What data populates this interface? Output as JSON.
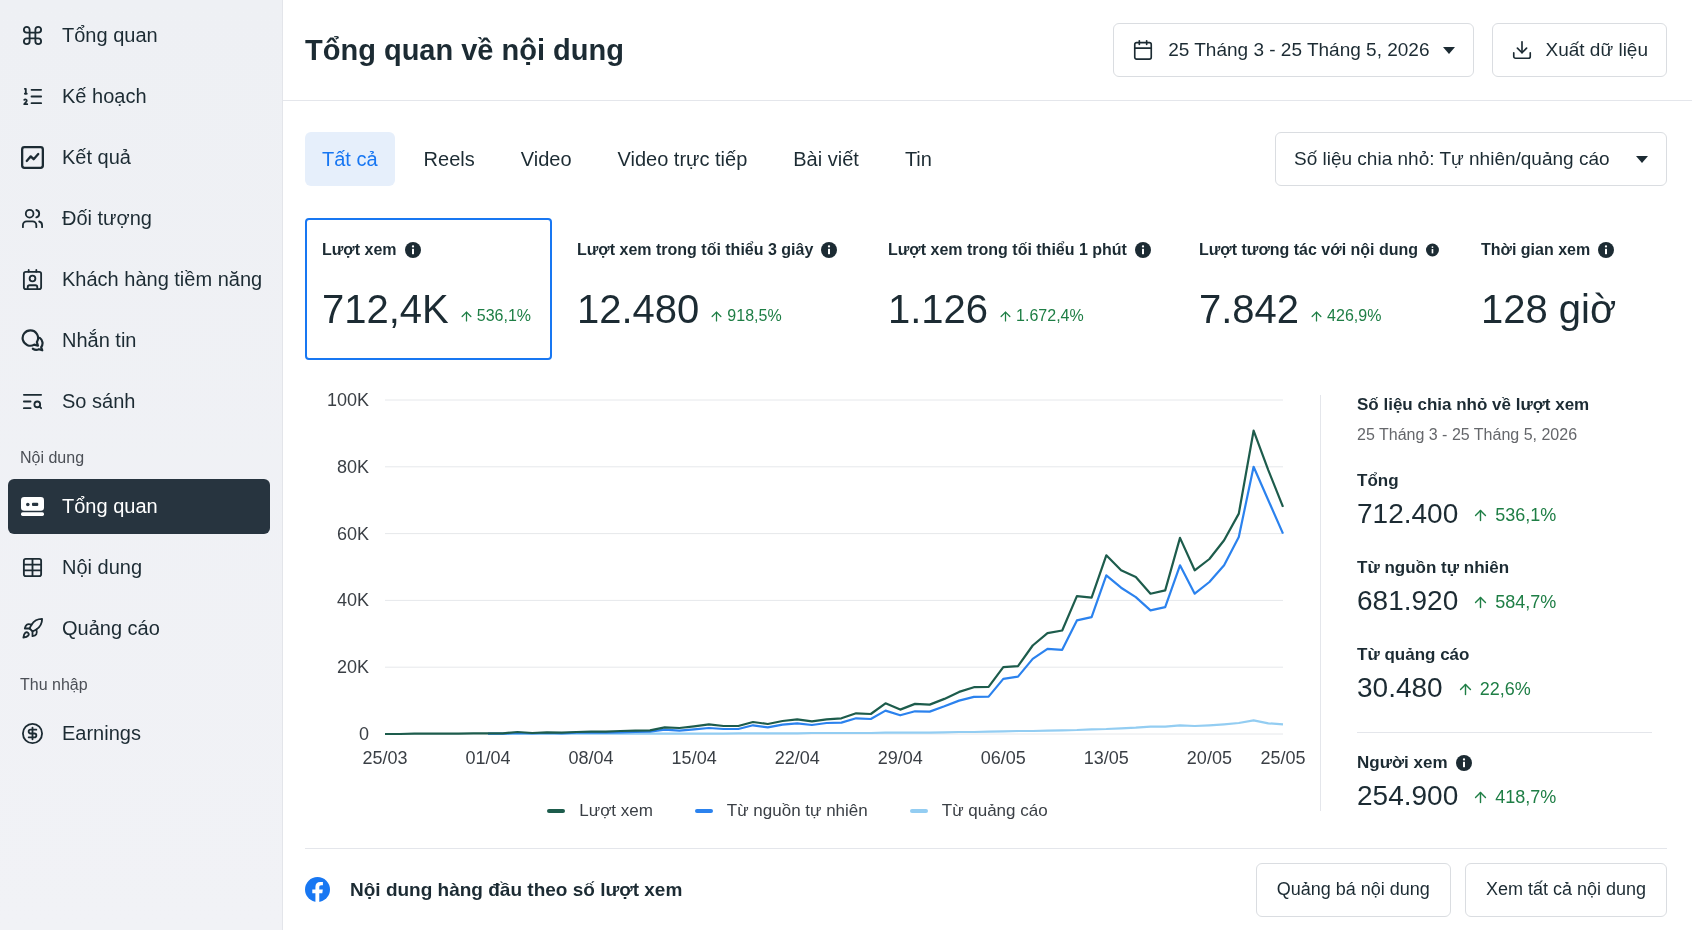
{
  "sidebar": {
    "groups": [
      {
        "items": [
          {
            "label": "Tổng quan",
            "selected": false
          },
          {
            "label": "Kế hoạch",
            "selected": false
          },
          {
            "label": "Kết quả",
            "selected": false
          },
          {
            "label": "Đối tượng",
            "selected": false
          },
          {
            "label": "Khách hàng tiềm năng",
            "selected": false
          },
          {
            "label": "Nhắn tin",
            "selected": false
          },
          {
            "label": "So sánh",
            "selected": false
          }
        ]
      },
      {
        "heading": "Nội dung",
        "items": [
          {
            "label": "Tổng quan",
            "selected": true
          },
          {
            "label": "Nội dung",
            "selected": false
          },
          {
            "label": "Quảng cáo",
            "selected": false
          }
        ]
      },
      {
        "heading": "Thu nhập",
        "items": [
          {
            "label": "Earnings",
            "selected": false
          }
        ]
      }
    ]
  },
  "header": {
    "title": "Tổng quan về nội dung",
    "date_range": "25 Tháng 3 - 25 Tháng 5, 2026",
    "export_button": "Xuất dữ liệu"
  },
  "tabs": [
    {
      "label": "Tất cả",
      "selected": true
    },
    {
      "label": "Reels",
      "selected": false
    },
    {
      "label": "Video",
      "selected": false
    },
    {
      "label": "Video trực tiếp",
      "selected": false
    },
    {
      "label": "Bài viết",
      "selected": false
    },
    {
      "label": "Tin",
      "selected": false
    }
  ],
  "breakdown_select": {
    "value": "Số liệu chia nhỏ: Tự nhiên/quảng cáo"
  },
  "metrics": [
    {
      "label": "Lượt xem",
      "info": true,
      "value": "712,4K",
      "change": "536,1%",
      "selected": true
    },
    {
      "label": "Lượt xem trong tối thiểu 3 giây",
      "info": true,
      "value": "12.480",
      "change": "918,5%",
      "selected": false
    },
    {
      "label": "Lượt xem trong tối thiểu 1 phút",
      "info": true,
      "value": "1.126",
      "change": "1.672,4%",
      "selected": false
    },
    {
      "label": "Lượt tương tác với nội dung",
      "info": true,
      "value": "7.842",
      "change": "426,9%",
      "selected": false
    },
    {
      "label": "Thời gian xem",
      "info": true,
      "value": "128 giờ",
      "selected": false
    }
  ],
  "views_chart": {
    "chart_data": {
      "type": "line",
      "grid": true,
      "categories": [
        "25/03",
        null,
        null,
        null,
        null,
        null,
        null,
        "01/04",
        null,
        null,
        null,
        null,
        null,
        null,
        "08/04",
        null,
        null,
        null,
        null,
        null,
        null,
        "15/04",
        null,
        null,
        null,
        null,
        null,
        null,
        "22/04",
        null,
        null,
        null,
        null,
        null,
        null,
        "29/04",
        null,
        null,
        null,
        null,
        null,
        null,
        "06/05",
        null,
        null,
        null,
        null,
        null,
        null,
        "13/05",
        null,
        null,
        null,
        null,
        null,
        null,
        "20/05",
        null,
        null,
        null,
        null,
        "25/05"
      ],
      "ylim": [
        0,
        100000
      ],
      "yticks": [
        {
          "value": 0,
          "label": "0"
        },
        {
          "value": 20000,
          "label": "20K"
        },
        {
          "value": 40000,
          "label": "40K"
        },
        {
          "value": 60000,
          "label": "60K"
        },
        {
          "value": 80000,
          "label": "80K"
        },
        {
          "value": 100000,
          "label": "100K"
        }
      ],
      "series": [
        {
          "name": "Lượt xem",
          "color": "#1d5c4c",
          "values": [
            0,
            0,
            100,
            100,
            100,
            100,
            200,
            200,
            200,
            600,
            300,
            500,
            400,
            600,
            700,
            700,
            900,
            1000,
            1100,
            2000,
            1800,
            2300,
            2900,
            2400,
            2400,
            3600,
            3000,
            3900,
            4400,
            3800,
            4400,
            4700,
            6200,
            6000,
            9200,
            7300,
            9000,
            8800,
            10500,
            12600,
            14000,
            14100,
            20000,
            20300,
            26500,
            30200,
            31000,
            41300,
            40800,
            53500,
            49000,
            47000,
            42000,
            43000,
            58700,
            49000,
            52400,
            58000,
            66000,
            90800,
            79000,
            68000
          ]
        },
        {
          "name": "Từ nguồn tự nhiên",
          "color": "#2b82ee",
          "values": [
            null,
            null,
            null,
            null,
            null,
            null,
            null,
            100,
            100,
            300,
            200,
            300,
            200,
            400,
            400,
            400,
            500,
            600,
            700,
            1300,
            1000,
            1400,
            1800,
            1500,
            1500,
            2600,
            2000,
            2800,
            3200,
            2700,
            3300,
            3400,
            4700,
            4500,
            7000,
            5600,
            6800,
            6700,
            8300,
            10000,
            11100,
            11200,
            16500,
            17200,
            22500,
            25500,
            25200,
            34000,
            35000,
            47500,
            43800,
            41000,
            37000,
            38000,
            50500,
            42000,
            45500,
            50500,
            59000,
            80000,
            70000,
            60000
          ]
        },
        {
          "name": "Từ quảng cáo",
          "color": "#93cdf2",
          "values": [
            null,
            null,
            null,
            null,
            null,
            null,
            null,
            0,
            0,
            0,
            100,
            100,
            100,
            100,
            100,
            100,
            100,
            100,
            100,
            100,
            100,
            100,
            100,
            100,
            200,
            200,
            200,
            200,
            200,
            300,
            300,
            300,
            300,
            300,
            400,
            400,
            400,
            400,
            500,
            600,
            600,
            700,
            800,
            900,
            900,
            1000,
            1100,
            1200,
            1400,
            1500,
            1700,
            1900,
            2200,
            2200,
            2600,
            2400,
            2600,
            2900,
            3300,
            4100,
            3200,
            2900
          ]
        }
      ]
    }
  },
  "breakdown_panel": {
    "title": "Số liệu chia nhỏ về lượt xem",
    "date_range": "25 Tháng 3 - 25 Tháng 5, 2026",
    "sections": [
      {
        "rows": [
          {
            "label": "Tổng",
            "info": false,
            "value": "712.400",
            "change": "536,1%"
          },
          {
            "label": "Từ nguồn tự nhiên",
            "info": false,
            "value": "681.920",
            "change": "584,7%"
          },
          {
            "label": "Từ quảng cáo",
            "info": false,
            "value": "30.480",
            "change": "22,6%"
          }
        ]
      },
      {
        "rows": [
          {
            "label": "Người xem",
            "info": true,
            "value": "254.900",
            "change": "418,7%"
          }
        ]
      }
    ]
  },
  "top_content": {
    "title": "Nội dung hàng đầu theo số lượt xem",
    "buttons": [
      "Quảng bá nội dung",
      "Xem tất cả nội dung"
    ]
  }
}
